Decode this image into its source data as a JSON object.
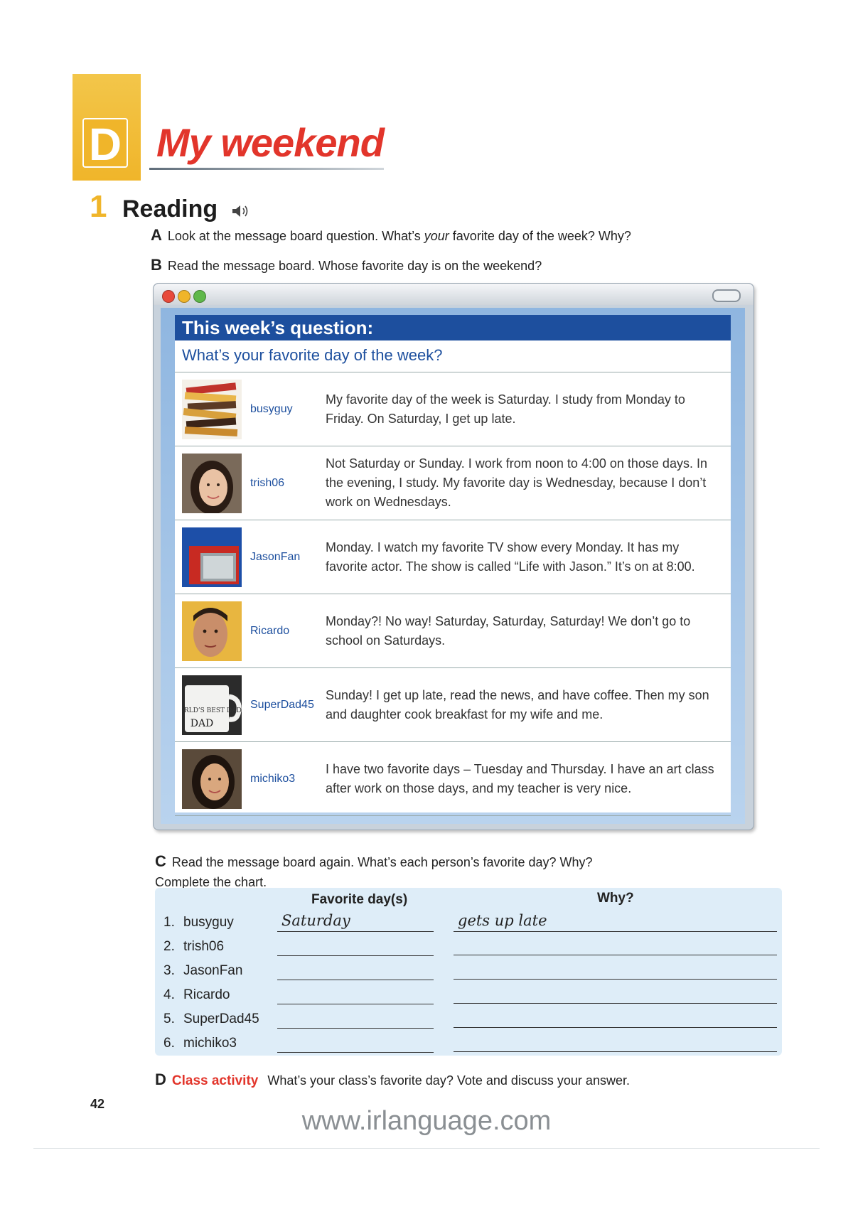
{
  "header": {
    "unit_letter": "D",
    "title": "My weekend"
  },
  "section": {
    "number": "1",
    "title": "Reading",
    "audio_icon": "speaker-icon"
  },
  "instructions": {
    "a": {
      "letter": "A",
      "pre": "Look at the message board question. What’s ",
      "em": "your",
      "post": " favorite day of the week? Why?"
    },
    "b": {
      "letter": "B",
      "text": "Read the message board. Whose favorite day is on the weekend?"
    },
    "c": {
      "letter": "C",
      "line1": "Read the message board again. What’s each person’s favorite day? Why?",
      "line2": "Complete the chart."
    },
    "d": {
      "letter": "D",
      "label": "Class activity",
      "text": "What’s your class’s favorite day? Vote and discuss your answer."
    }
  },
  "board": {
    "heading": "This week’s question:",
    "question": "What’s your favorite day of the week?",
    "posts": [
      {
        "user": "busyguy",
        "icon": "books-icon",
        "message": "My favorite day of the week is Saturday. I study from Monday to Friday. On Saturday, I get up late."
      },
      {
        "user": "trish06",
        "icon": "woman-avatar-icon",
        "message": "Not Saturday or Sunday. I work from noon to 4:00 on those days. In the evening, I study. My favorite day is Wednesday, because I don’t work on Wednesdays."
      },
      {
        "user": "JasonFan",
        "icon": "tv-icon",
        "message": "Monday. I watch my favorite TV show every Monday. It has my favorite actor. The show is called “Life with Jason.” It’s on at 8:00."
      },
      {
        "user": "Ricardo",
        "icon": "man-avatar-icon",
        "message": "Monday?! No way! Saturday, Saturday, Saturday! We don’t go to school on Saturdays."
      },
      {
        "user": "SuperDad45",
        "icon": "mug-icon",
        "mug_text": "WORLD’S BEST DAD",
        "message": "Sunday! I get up late, read the news, and have coffee. Then my son and daughter cook breakfast for my wife and me."
      },
      {
        "user": "michiko3",
        "icon": "woman-avatar-icon",
        "message": "I have two favorite days – Tuesday and Thursday. I have an art class after work on those days, and my teacher is very nice."
      }
    ]
  },
  "chart": {
    "col_favorite": "Favorite day(s)",
    "col_why": "Why?",
    "rows": [
      {
        "num": "1.",
        "name": "busyguy",
        "day": "Saturday",
        "why": "gets up late"
      },
      {
        "num": "2.",
        "name": "trish06",
        "day": "",
        "why": ""
      },
      {
        "num": "3.",
        "name": "JasonFan",
        "day": "",
        "why": ""
      },
      {
        "num": "4.",
        "name": "Ricardo",
        "day": "",
        "why": ""
      },
      {
        "num": "5.",
        "name": "SuperDad45",
        "day": "",
        "why": ""
      },
      {
        "num": "6.",
        "name": "michiko3",
        "day": "",
        "why": ""
      }
    ]
  },
  "footer": {
    "page_number": "42",
    "watermark": "www.irlanguage.com"
  },
  "colors": {
    "title_red": "#e2352b",
    "tab_yellow": "#f0b52a",
    "board_blue": "#1d4f9e"
  }
}
